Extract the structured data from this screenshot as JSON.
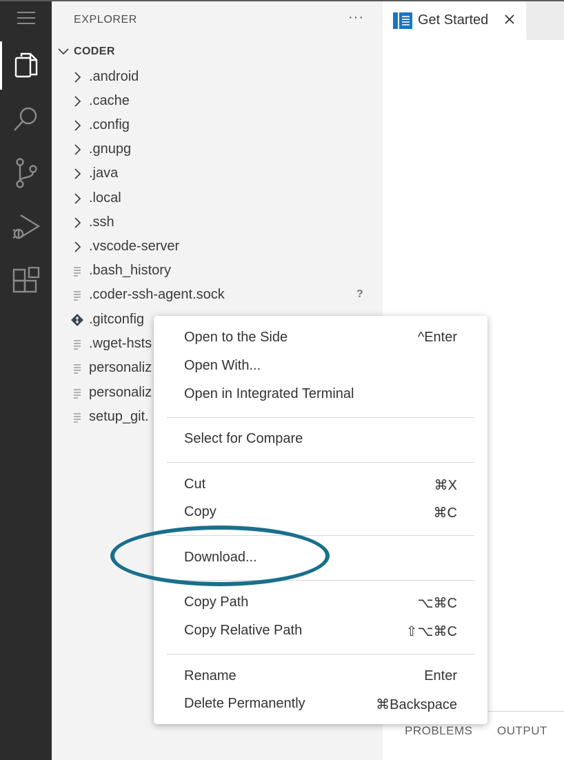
{
  "activity_bar": {
    "items": [
      {
        "icon": "menu-icon"
      },
      {
        "icon": "files-icon",
        "active": true
      },
      {
        "icon": "search-icon"
      },
      {
        "icon": "source-control-icon"
      },
      {
        "icon": "run-debug-icon"
      },
      {
        "icon": "extensions-icon"
      }
    ]
  },
  "sidebar": {
    "title": "EXPLORER",
    "more": "···",
    "root": "CODER",
    "items": [
      {
        "label": ".android",
        "type": "folder"
      },
      {
        "label": ".cache",
        "type": "folder"
      },
      {
        "label": ".config",
        "type": "folder"
      },
      {
        "label": ".gnupg",
        "type": "folder"
      },
      {
        "label": ".java",
        "type": "folder"
      },
      {
        "label": ".local",
        "type": "folder"
      },
      {
        "label": ".ssh",
        "type": "folder"
      },
      {
        "label": ".vscode-server",
        "type": "folder"
      },
      {
        "label": ".bash_history",
        "type": "file"
      },
      {
        "label": ".coder-ssh-agent.sock",
        "type": "file",
        "badge": "?"
      },
      {
        "label": ".gitconfig",
        "type": "git"
      },
      {
        "label": ".wget-hsts",
        "type": "file"
      },
      {
        "label": "personaliz",
        "type": "file"
      },
      {
        "label": "personaliz",
        "type": "file"
      },
      {
        "label": "setup_git.",
        "type": "file"
      }
    ]
  },
  "editor": {
    "tab": {
      "label": "Get Started",
      "icon": "get-started-icon"
    }
  },
  "panel": {
    "tabs": [
      "PROBLEMS",
      "OUTPUT"
    ]
  },
  "context_menu": {
    "groups": [
      [
        {
          "label": "Open to the Side",
          "shortcut": "^Enter"
        },
        {
          "label": "Open With...",
          "shortcut": ""
        },
        {
          "label": "Open in Integrated Terminal",
          "shortcut": ""
        }
      ],
      [
        {
          "label": "Select for Compare",
          "shortcut": ""
        }
      ],
      [
        {
          "label": "Cut",
          "shortcut": "⌘X"
        },
        {
          "label": "Copy",
          "shortcut": "⌘C"
        }
      ],
      [
        {
          "label": "Download...",
          "shortcut": "",
          "highlighted": true
        }
      ],
      [
        {
          "label": "Copy Path",
          "shortcut": "⌥⌘C"
        },
        {
          "label": "Copy Relative Path",
          "shortcut": "⇧⌥⌘C"
        }
      ],
      [
        {
          "label": "Rename",
          "shortcut": "Enter"
        },
        {
          "label": "Delete Permanently",
          "shortcut": "⌘Backspace"
        }
      ]
    ]
  },
  "colors": {
    "activity_bar_bg": "#2c2c2c",
    "sidebar_bg": "#f3f3f3",
    "highlight_ring": "#1a6f8c",
    "tab_icon": "#1a74c4"
  }
}
